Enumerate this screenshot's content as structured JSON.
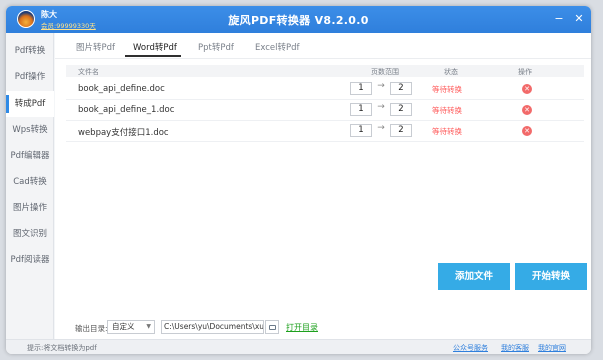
{
  "app": {
    "title": "旋风PDF转换器 V8.2.0.0"
  },
  "user": {
    "name": "陈大",
    "vip": "会员:99999330天",
    "avatar_icon": "user-avatar"
  },
  "window_controls": {
    "minimize": "−",
    "close": "✕"
  },
  "sidebar": {
    "items": [
      {
        "label": "Pdf转换",
        "active": false
      },
      {
        "label": "Pdf操作",
        "active": false
      },
      {
        "label": "转成Pdf",
        "active": true
      },
      {
        "label": "Wps转换",
        "active": false
      },
      {
        "label": "Pdf编辑器",
        "active": false
      },
      {
        "label": "Cad转换",
        "active": false
      },
      {
        "label": "图片操作",
        "active": false
      },
      {
        "label": "图文识别",
        "active": false
      },
      {
        "label": "Pdf阅读器",
        "active": false
      }
    ]
  },
  "tabs": [
    {
      "label": "图片转Pdf",
      "active": false
    },
    {
      "label": "Word转Pdf",
      "active": true
    },
    {
      "label": "Ppt转Pdf",
      "active": false
    },
    {
      "label": "Excel转Pdf",
      "active": false
    }
  ],
  "table": {
    "headers": {
      "name": "文件名",
      "pages": "页数范围",
      "status": "状态",
      "action": "操作"
    },
    "rows": [
      {
        "name": "book_api_define.doc",
        "from": "1",
        "to": "2",
        "status": "等待转换"
      },
      {
        "name": "book_api_define_1.doc",
        "from": "1",
        "to": "2",
        "status": "等待转换"
      },
      {
        "name": "webpay支付接口1.doc",
        "from": "1",
        "to": "2",
        "status": "等待转换"
      }
    ],
    "arrow": "→",
    "delete_icon": "delete-icon",
    "status_color": "#ff5a5a"
  },
  "buttons": {
    "add_file": "添加文件",
    "start": "开始转换",
    "color": "#35abe6"
  },
  "output": {
    "label": "输出目录:",
    "select_value": "自定义",
    "path": "C:\\Users\\yu\\Documents\\xuanfe",
    "open_dir": "打开目录"
  },
  "statusbar": {
    "tip": "提示:将文档转换为pdf",
    "links": [
      "公众号服务",
      "我的客服",
      "我的官网"
    ]
  },
  "colors": {
    "titlebar": "#2f7fdc",
    "accent": "#2f8ae6"
  }
}
